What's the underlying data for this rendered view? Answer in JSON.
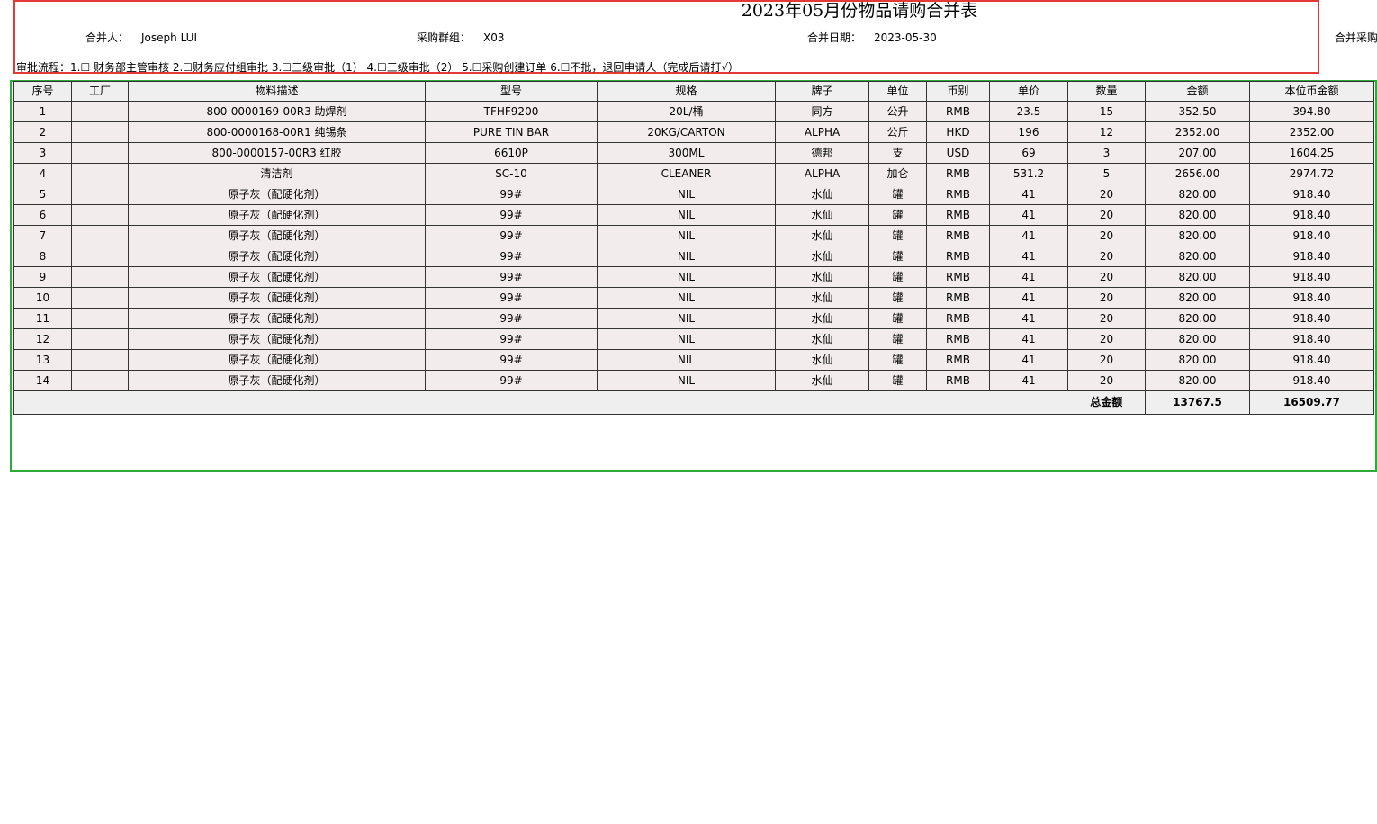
{
  "header": {
    "title": "2023年05月份物品请购合并表",
    "merger_label": "合并人：",
    "merger_value": "Joseph LUI",
    "group_label": "采购群组：",
    "group_value": "X03",
    "date_label": "合并日期：",
    "date_value": "2023-05-30",
    "overflow_label": "合并采购",
    "approval_text": "审批流程：1.☐  财务部主管审核 2.☐财务应付组审批 3.☐三级审批（1） 4.☐三级审批（2） 5.☐采购创建订单 6.☐不批，退回申请人（完成后请打√）"
  },
  "table": {
    "columns": [
      "序号",
      "工厂",
      "物料描述",
      "型号",
      "规格",
      "牌子",
      "单位",
      "币别",
      "单价",
      "数量",
      "金额",
      "本位币金额"
    ],
    "rows": [
      [
        "1",
        "",
        "800-0000169-00R3 助焊剂",
        "TFHF9200",
        "20L/桶",
        "同方",
        "公升",
        "RMB",
        "23.5",
        "15",
        "352.50",
        "394.80"
      ],
      [
        "2",
        "",
        "800-0000168-00R1 纯锡条",
        "PURE TIN BAR",
        "20KG/CARTON",
        "ALPHA",
        "公斤",
        "HKD",
        "196",
        "12",
        "2352.00",
        "2352.00"
      ],
      [
        "3",
        "",
        "800-0000157-00R3 红胶",
        "6610P",
        "300ML",
        "德邦",
        "支",
        "USD",
        "69",
        "3",
        "207.00",
        "1604.25"
      ],
      [
        "4",
        "",
        "清洁剂",
        "SC-10",
        "CLEANER",
        "ALPHA",
        "加仑",
        "RMB",
        "531.2",
        "5",
        "2656.00",
        "2974.72"
      ],
      [
        "5",
        "",
        "原子灰（配硬化剂）",
        "99#",
        "NIL",
        "水仙",
        "罐",
        "RMB",
        "41",
        "20",
        "820.00",
        "918.40"
      ],
      [
        "6",
        "",
        "原子灰（配硬化剂）",
        "99#",
        "NIL",
        "水仙",
        "罐",
        "RMB",
        "41",
        "20",
        "820.00",
        "918.40"
      ],
      [
        "7",
        "",
        "原子灰（配硬化剂）",
        "99#",
        "NIL",
        "水仙",
        "罐",
        "RMB",
        "41",
        "20",
        "820.00",
        "918.40"
      ],
      [
        "8",
        "",
        "原子灰（配硬化剂）",
        "99#",
        "NIL",
        "水仙",
        "罐",
        "RMB",
        "41",
        "20",
        "820.00",
        "918.40"
      ],
      [
        "9",
        "",
        "原子灰（配硬化剂）",
        "99#",
        "NIL",
        "水仙",
        "罐",
        "RMB",
        "41",
        "20",
        "820.00",
        "918.40"
      ],
      [
        "10",
        "",
        "原子灰（配硬化剂）",
        "99#",
        "NIL",
        "水仙",
        "罐",
        "RMB",
        "41",
        "20",
        "820.00",
        "918.40"
      ],
      [
        "11",
        "",
        "原子灰（配硬化剂）",
        "99#",
        "NIL",
        "水仙",
        "罐",
        "RMB",
        "41",
        "20",
        "820.00",
        "918.40"
      ],
      [
        "12",
        "",
        "原子灰（配硬化剂）",
        "99#",
        "NIL",
        "水仙",
        "罐",
        "RMB",
        "41",
        "20",
        "820.00",
        "918.40"
      ],
      [
        "13",
        "",
        "原子灰（配硬化剂）",
        "99#",
        "NIL",
        "水仙",
        "罐",
        "RMB",
        "41",
        "20",
        "820.00",
        "918.40"
      ],
      [
        "14",
        "",
        "原子灰（配硬化剂）",
        "99#",
        "NIL",
        "水仙",
        "罐",
        "RMB",
        "41",
        "20",
        "820.00",
        "918.40"
      ]
    ],
    "total_label": "总金额",
    "total_amount": "13767.5",
    "total_local": "16509.77"
  }
}
